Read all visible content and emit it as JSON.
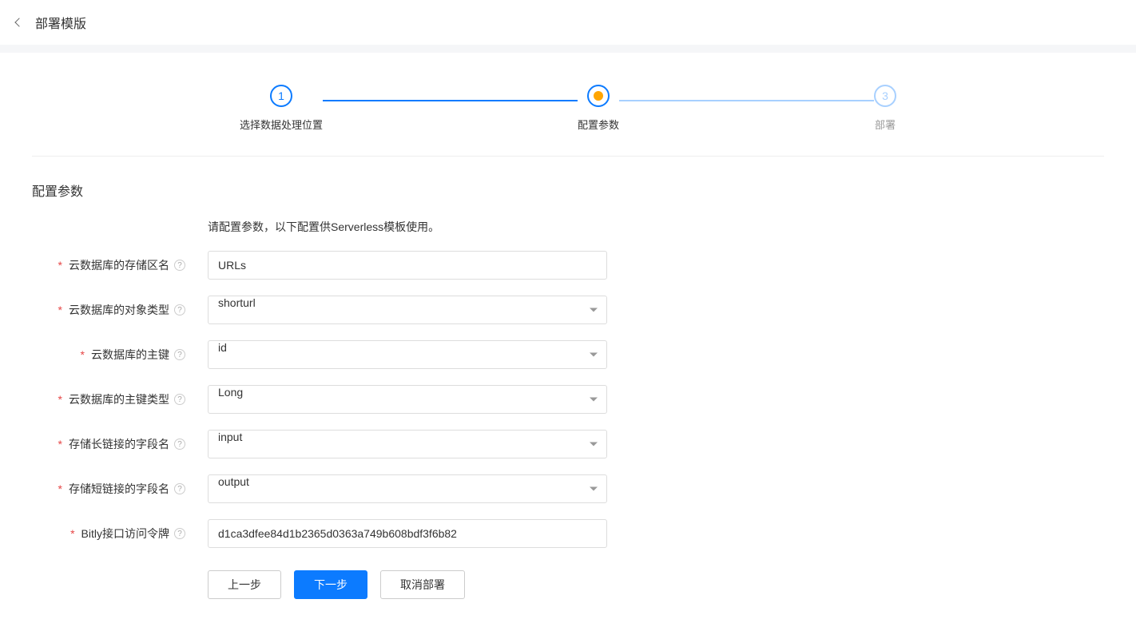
{
  "header": {
    "title": "部署模版"
  },
  "steps": {
    "s1": {
      "num": "1",
      "label": "选择数据处理位置"
    },
    "s2": {
      "label": "配置参数"
    },
    "s3": {
      "num": "3",
      "label": "部署"
    }
  },
  "section": {
    "title": "配置参数",
    "desc": "请配置参数，以下配置供Serverless模板使用。"
  },
  "form": {
    "f1": {
      "label": "云数据库的存储区名",
      "value": "URLs"
    },
    "f2": {
      "label": "云数据库的对象类型",
      "value": "shorturl"
    },
    "f3": {
      "label": "云数据库的主键",
      "value": "id"
    },
    "f4": {
      "label": "云数据库的主键类型",
      "value": "Long"
    },
    "f5": {
      "label": "存储长链接的字段名",
      "value": "input"
    },
    "f6": {
      "label": "存储短链接的字段名",
      "value": "output"
    },
    "f7": {
      "label": "Bitly接口访问令牌",
      "value": "d1ca3dfee84d1b2365d0363a749b608bdf3f6b82"
    }
  },
  "buttons": {
    "prev": "上一步",
    "next": "下一步",
    "cancel": "取消部署"
  },
  "help": "?"
}
